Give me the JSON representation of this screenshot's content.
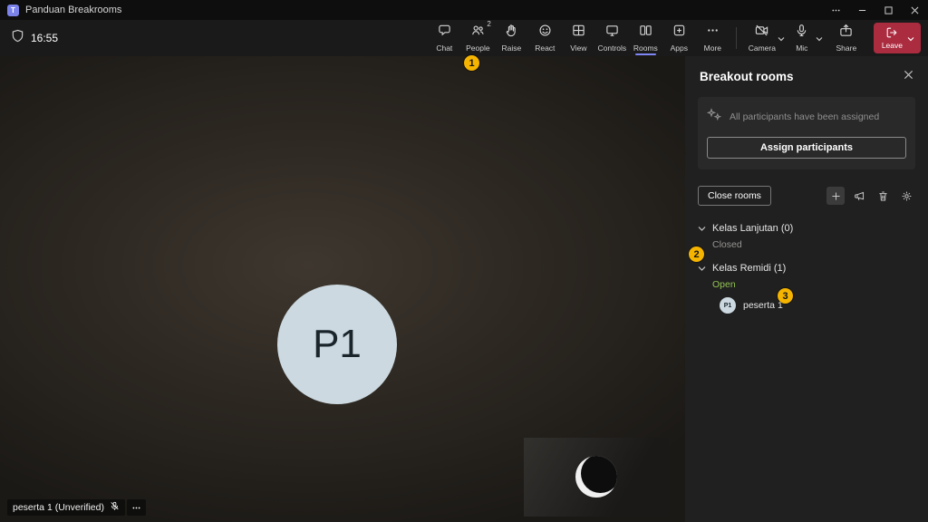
{
  "titlebar": {
    "title": "Panduan Breakrooms"
  },
  "toolbar": {
    "timer": "16:55",
    "buttons": [
      {
        "label": "Chat"
      },
      {
        "label": "People",
        "badge": "2"
      },
      {
        "label": "Raise"
      },
      {
        "label": "React"
      },
      {
        "label": "View"
      },
      {
        "label": "Controls"
      },
      {
        "label": "Rooms"
      },
      {
        "label": "Apps"
      },
      {
        "label": "More"
      }
    ],
    "camera": {
      "label": "Camera"
    },
    "mic": {
      "label": "Mic"
    },
    "share": {
      "label": "Share"
    },
    "leave": {
      "label": "Leave"
    }
  },
  "stage": {
    "participant_initials": "P1",
    "nameplate": "peserta 1 (Unverified)"
  },
  "panel": {
    "title": "Breakout rooms",
    "assigned_message": "All participants have been assigned",
    "assign_button": "Assign participants",
    "close_rooms_button": "Close rooms",
    "rooms": [
      {
        "name": "Kelas Lanjutan (0)",
        "status": "Closed",
        "status_color": "#979593"
      },
      {
        "name": "Kelas Remidi (1)",
        "status": "Open",
        "status_color": "#92c353",
        "participant": {
          "initials": "P1",
          "name": "peserta 1"
        }
      }
    ]
  },
  "annotations": {
    "1": "1",
    "2": "2",
    "3": "3"
  },
  "colors": {
    "accent": "#7f85f5",
    "leave_red": "#ab2b3f",
    "annotation_yellow": "#f5b400",
    "open_green": "#92c353",
    "closed_gray": "#979593",
    "avatar_bg": "#ccd9e0"
  }
}
